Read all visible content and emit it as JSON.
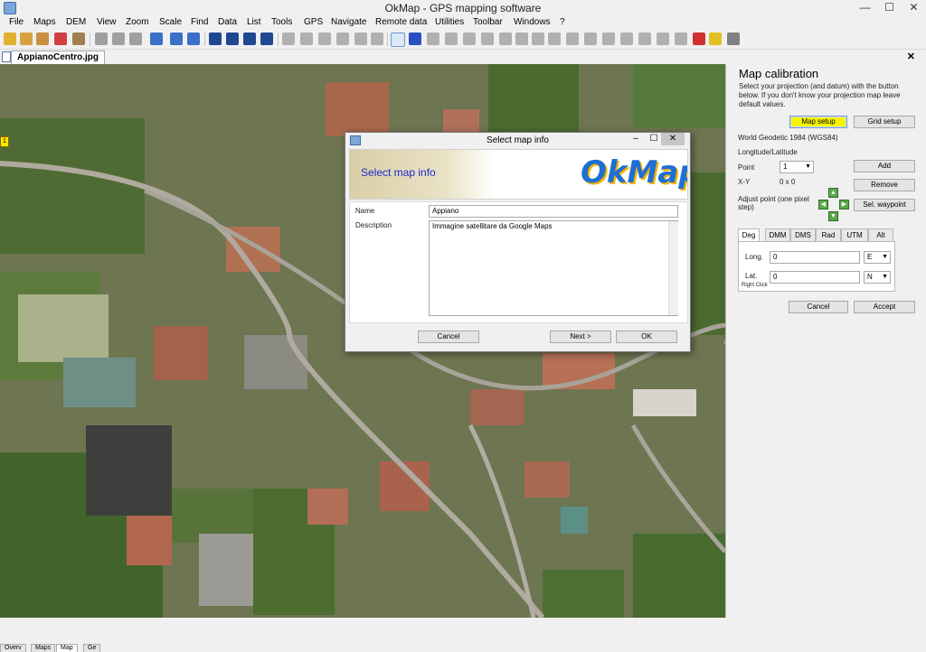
{
  "window": {
    "title": "OkMap - GPS mapping software",
    "minimize": "—",
    "maximize": "☐",
    "close": "✕"
  },
  "menu": [
    "File",
    "Maps",
    "DEM",
    "View",
    "Zoom",
    "Scale",
    "Find",
    "Data",
    "List",
    "Tools",
    "GPS",
    "Navigate",
    "Remote data",
    "Utilities",
    "Toolbar",
    "Windows",
    "?"
  ],
  "document_tab": {
    "label": "AppianoCentro.jpg",
    "close": "✕"
  },
  "panel": {
    "title": "Map calibration",
    "description": "Select your projection (and datum) with the button below. If you don't know your projection map leave default values.",
    "map_setup": "Map setup",
    "grid_setup": "Grid setup",
    "datum": "World Geodetic 1984 (WGS84)",
    "projection": "Longitude/Latitude",
    "point_label": "Point",
    "point_value": "1",
    "xy_label": "X-Y",
    "xy_value": "0 x 0",
    "adjust_label": "Adjust point (one pixel step)",
    "add": "Add",
    "remove": "Remove",
    "sel_waypoint": "Sel. waypoint",
    "unit_tabs": [
      "Deg",
      "DMM",
      "DMS",
      "Rad",
      "UTM",
      "Alt"
    ],
    "long_label": "Long.",
    "long_value": "0",
    "long_dir": "E",
    "lat_label": "Lat.",
    "lat_value": "0",
    "lat_dir": "N",
    "right_click": "Right Click",
    "cancel": "Cancel",
    "accept": "Accept"
  },
  "dialog": {
    "title": "Select map info",
    "banner_text": "Select map info",
    "logo": "OkMap",
    "name_label": "Name",
    "name_value": "Appiano",
    "description_label": "Description",
    "description_value": "Immagine satellitare da Google Maps",
    "cancel": "Cancel",
    "next": "Next >",
    "ok": "OK"
  },
  "status_tabs": [
    "Overv",
    "Maps",
    "Map",
    "Ge"
  ],
  "colors": {
    "accent_highlight": "#f7f400",
    "logo_blue": "#1e6fd4",
    "banner_text": "#1a2bd0"
  }
}
